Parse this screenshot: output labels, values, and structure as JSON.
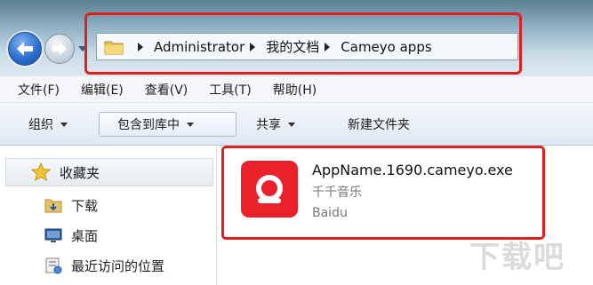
{
  "address": {
    "breadcrumbs": [
      "Administrator",
      "我的文档",
      "Cameyo apps"
    ]
  },
  "menu": {
    "items": [
      "文件(F)",
      "编辑(E)",
      "查看(V)",
      "工具(T)",
      "帮助(H)"
    ]
  },
  "toolbar": {
    "organize": "组织",
    "include_in_library": "包含到库中",
    "share": "共享",
    "new_folder": "新建文件夹"
  },
  "sidebar": {
    "favorites": "收藏夹",
    "items": [
      {
        "label": "下载",
        "icon": "download-folder-icon"
      },
      {
        "label": "桌面",
        "icon": "desktop-icon"
      },
      {
        "label": "最近访问的位置",
        "icon": "recent-places-icon"
      }
    ]
  },
  "file": {
    "name": "AppName.1690.cameyo.exe",
    "description": "千千音乐",
    "company": "Baidu",
    "icon": "qianqian-music-app-icon",
    "icon_color": "#e8212b"
  },
  "watermark": "下载吧",
  "colors": {
    "highlight": "#e02020",
    "nav_back": "#2c6fd0"
  }
}
